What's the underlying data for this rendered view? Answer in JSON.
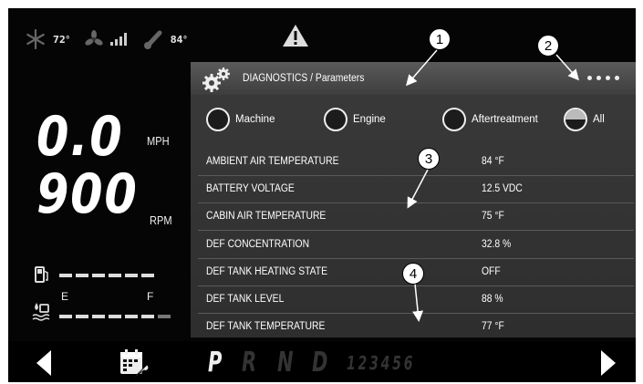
{
  "status": {
    "outside_temp": "72°",
    "engine_temp": "84°"
  },
  "icons": {
    "snowflake": "snowflake-icon",
    "fan": "fan-icon",
    "signal": "signal-bars-icon",
    "thermometer": "thermometer-icon",
    "warning": "warning-icon",
    "gears": "gears-icon",
    "fuel": "fuel-icon",
    "def": "def-fluid-icon",
    "calendar_wrench": "calendar-wrench-icon",
    "left_arrow": "left-arrow-icon",
    "right_arrow": "right-arrow-icon"
  },
  "dash": {
    "speed": "0.0",
    "speed_unit": "MPH",
    "rpm": "900",
    "rpm_unit": "RPM",
    "gauge_empty": "E",
    "gauge_full": "F"
  },
  "diagnostics": {
    "title": "DIAGNOSTICS / Parameters",
    "filters": [
      {
        "label": "Machine",
        "selected": false
      },
      {
        "label": "Engine",
        "selected": false
      },
      {
        "label": "Aftertreatment",
        "selected": false
      },
      {
        "label": "All",
        "selected": true
      }
    ],
    "rows": [
      {
        "name": "AMBIENT AIR TEMPERATURE",
        "value": "84 °F"
      },
      {
        "name": "BATTERY VOLTAGE",
        "value": "12.5 VDC"
      },
      {
        "name": "CABIN AIR TEMPERATURE",
        "value": "75 °F"
      },
      {
        "name": "DEF CONCENTRATION",
        "value": "32.8 %"
      },
      {
        "name": "DEF TANK HEATING STATE",
        "value": "OFF"
      },
      {
        "name": "DEF TANK LEVEL",
        "value": "88 %"
      },
      {
        "name": "DEF TANK TEMPERATURE",
        "value": "77 °F"
      }
    ]
  },
  "callouts": [
    "1",
    "2",
    "3",
    "4"
  ],
  "gear_selector": {
    "active": "P",
    "gears": [
      "P",
      "R",
      "N",
      "D"
    ],
    "ranges": "123456"
  },
  "colors": {
    "background": "#050505",
    "panel": "#333333",
    "text": "#ffffff",
    "inactive_gear": "#333333"
  }
}
